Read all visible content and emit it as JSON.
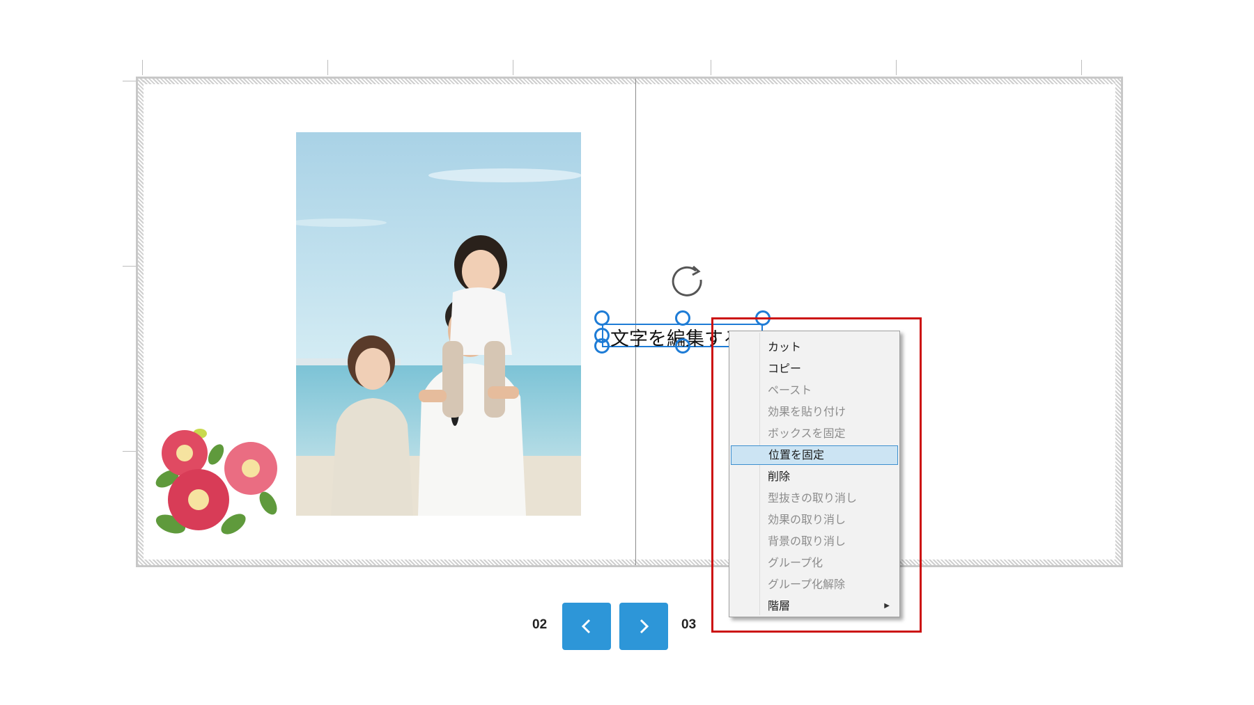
{
  "canvas": {
    "text_box": {
      "text": "文字を編集する"
    },
    "photo": {
      "alt": "family-beach-photo"
    },
    "decoration": "camellia-flowers"
  },
  "context_menu": {
    "items": [
      {
        "label": "カット",
        "enabled": true
      },
      {
        "label": "コピー",
        "enabled": true
      },
      {
        "label": "ペースト",
        "enabled": false
      },
      {
        "label": "効果を貼り付け",
        "enabled": false
      },
      {
        "label": "ボックスを固定",
        "enabled": false
      },
      {
        "label": "位置を固定",
        "enabled": true,
        "highlighted": true
      },
      {
        "label": "削除",
        "enabled": true
      },
      {
        "label": "型抜きの取り消し",
        "enabled": false
      },
      {
        "label": "効果の取り消し",
        "enabled": false
      },
      {
        "label": "背景の取り消し",
        "enabled": false
      },
      {
        "label": "グループ化",
        "enabled": false
      },
      {
        "label": "グループ化解除",
        "enabled": false
      },
      {
        "label": "階層",
        "enabled": true,
        "submenu": true
      }
    ]
  },
  "pagination": {
    "left_page": "02",
    "right_page": "03",
    "prev_icon": "chevron-left-icon",
    "next_icon": "chevron-right-icon"
  },
  "colors": {
    "accent": "#2d96d8",
    "selection": "#1e7cd6",
    "highlight_box": "#cc1111",
    "menu_highlight": "#cce4f3"
  }
}
